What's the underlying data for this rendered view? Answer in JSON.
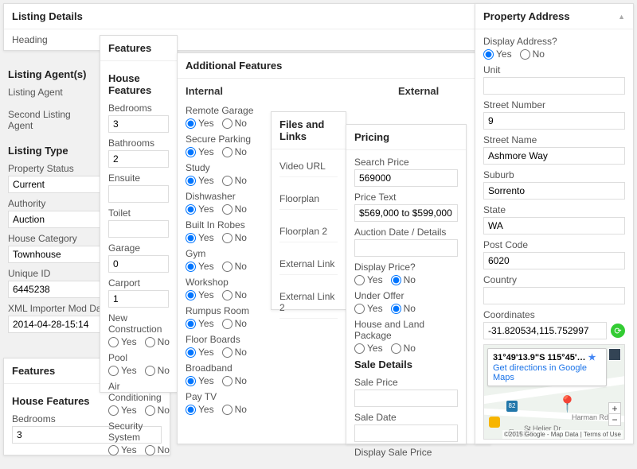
{
  "yes": "Yes",
  "no": "No",
  "listingDetails": {
    "title": "Listing Details",
    "heading": "Heading"
  },
  "listingAgents": {
    "title": "Listing Agent(s)",
    "a1": "Listing Agent",
    "a2": "Second Listing Agent"
  },
  "listingType": {
    "title": "Listing Type",
    "propertyStatus": {
      "l": "Property Status",
      "v": "Current"
    },
    "authority": {
      "l": "Authority",
      "v": "Auction"
    },
    "houseCategory": {
      "l": "House Category",
      "v": "Townhouse"
    },
    "uniqueId": {
      "l": "Unique ID",
      "v": "6445238"
    },
    "xmlDate": {
      "l": "XML Importer Mod Date",
      "v": "2014-04-28-15:14"
    }
  },
  "featuresDup": {
    "title": "Features",
    "hf": "House Features",
    "bedrooms": {
      "l": "Bedrooms",
      "v": "3"
    }
  },
  "features": {
    "title": "Features",
    "hf": "House Features",
    "bedrooms": {
      "l": "Bedrooms",
      "v": "3"
    },
    "bathrooms": {
      "l": "Bathrooms",
      "v": "2"
    },
    "ensuite": {
      "l": "Ensuite",
      "v": ""
    },
    "toilet": {
      "l": "Toilet",
      "v": ""
    },
    "garage": {
      "l": "Garage",
      "v": "0"
    },
    "carport": {
      "l": "Carport",
      "v": "1"
    },
    "newCon": "New Construction",
    "pool": "Pool",
    "ac": "Air Conditioning",
    "ss": "Security System"
  },
  "addFeat": {
    "title": "Additional Features",
    "internal": "Internal",
    "external": "External",
    "items": {
      "remoteGarage": "Remote Garage",
      "secureParking": "Secure Parking",
      "study": "Study",
      "dishwasher": "Dishwasher",
      "builtInRobes": "Built In Robes",
      "gym": "Gym",
      "workshop": "Workshop",
      "rumpus": "Rumpus Room",
      "floorBoards": "Floor Boards",
      "broadband": "Broadband",
      "payTv": "Pay TV"
    }
  },
  "files": {
    "title": "Files and Links",
    "items": [
      "Video URL",
      "Floorplan",
      "Floorplan 2",
      "External Link",
      "External Link 2"
    ]
  },
  "pricing": {
    "title": "Pricing",
    "searchPrice": {
      "l": "Search Price",
      "v": "569000"
    },
    "priceText": {
      "l": "Price Text",
      "v": "$569,000 to $599,000"
    },
    "auction": {
      "l": "Auction Date / Details",
      "v": ""
    },
    "displayPrice": "Display Price?",
    "underOffer": "Under Offer",
    "hlp": "House and Land Package",
    "saleDetails": "Sale Details",
    "salePrice": "Sale Price",
    "saleDate": "Sale Date",
    "dsp": "Display Sale Price"
  },
  "addr": {
    "title": "Property Address",
    "displayAddress": "Display Address?",
    "unit": {
      "l": "Unit",
      "v": ""
    },
    "streetNumber": {
      "l": "Street Number",
      "v": "9"
    },
    "streetName": {
      "l": "Street Name",
      "v": "Ashmore Way"
    },
    "suburb": {
      "l": "Suburb",
      "v": "Sorrento"
    },
    "state": {
      "l": "State",
      "v": "WA"
    },
    "postcode": {
      "l": "Post Code",
      "v": "6020"
    },
    "country": {
      "l": "Country",
      "v": ""
    },
    "coords": {
      "l": "Coordinates",
      "v": "-31.820534,115.752997"
    },
    "map": {
      "coordLabel": "31°49'13.9\"S 115°45'…",
      "directions": "Get directions in Google Maps",
      "r1": "Harman Rd",
      "r2": "St Helier Dr",
      "shield": "82",
      "logo": "Google",
      "terms": "©2015 Google - Map Data | Terms of Use"
    }
  }
}
